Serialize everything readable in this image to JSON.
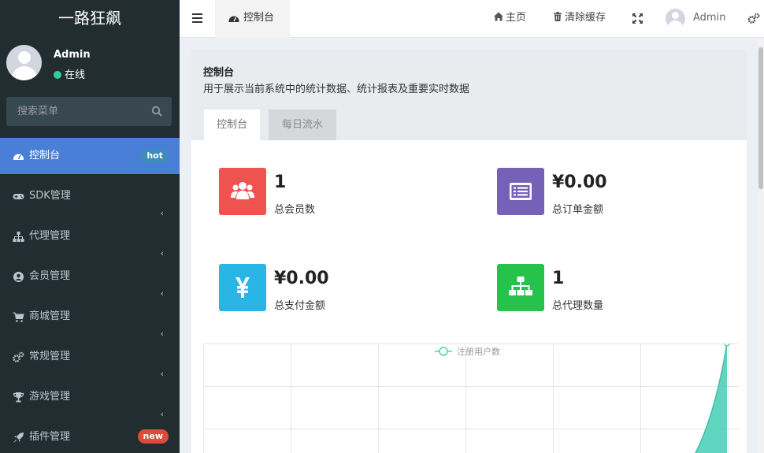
{
  "brand": "一路狂飙",
  "user": {
    "name": "Admin",
    "status": "在线"
  },
  "search": {
    "placeholder": "搜索菜单"
  },
  "menu": [
    {
      "label": "控制台",
      "badge": "hot",
      "icon": "dashboard-icon"
    },
    {
      "label": "SDK管理",
      "icon": "gamepad-icon"
    },
    {
      "label": "代理管理",
      "icon": "sitemap-icon"
    },
    {
      "label": "会员管理",
      "icon": "user-circle-icon"
    },
    {
      "label": "商城管理",
      "icon": "cart-icon"
    },
    {
      "label": "常规管理",
      "icon": "cogs-icon"
    },
    {
      "label": "游戏管理",
      "icon": "trophy-icon"
    },
    {
      "label": "插件管理",
      "badge": "new",
      "icon": "rocket-icon"
    }
  ],
  "header": {
    "tab": "控制台",
    "home": "主页",
    "clear_cache": "清除缓存",
    "admin": "Admin"
  },
  "page": {
    "title": "控制台",
    "desc": "用于展示当前系统中的统计数据、统计报表及重要实时数据",
    "tabs": [
      "控制台",
      "每日流水"
    ]
  },
  "stats": [
    {
      "value": "1",
      "label": "总会员数",
      "color": "#ef5350",
      "icon": "users-icon"
    },
    {
      "value": "¥0.00",
      "label": "总订单金额",
      "color": "#7561b8",
      "icon": "list-alt-icon"
    },
    {
      "value": "¥0.00",
      "label": "总支付金额",
      "color": "#29b6e6",
      "icon": "yen-icon"
    },
    {
      "value": "1",
      "label": "总代理数量",
      "color": "#27c24c",
      "icon": "sitemap-icon"
    }
  ],
  "chart_data": {
    "type": "area",
    "legend": [
      "注册用户数"
    ],
    "series": [
      {
        "name": "注册用户数",
        "color": "#4fd1b9"
      }
    ]
  }
}
